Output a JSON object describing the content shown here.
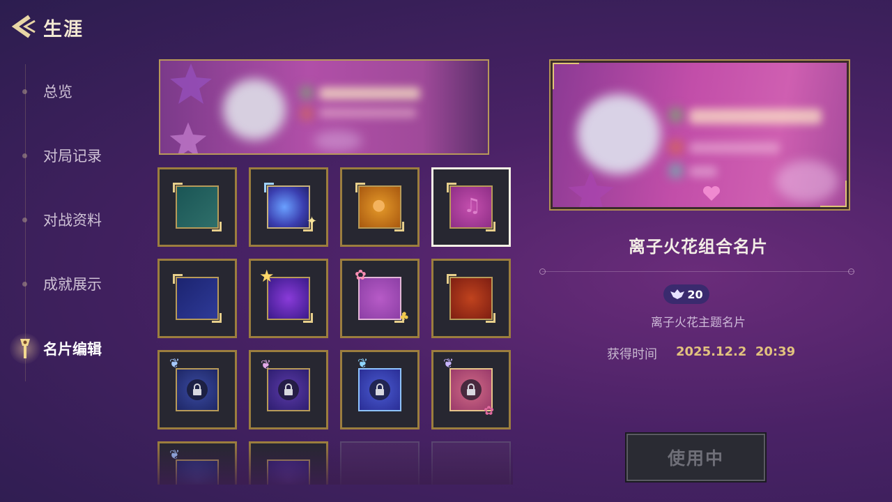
{
  "header": {
    "title": "生涯",
    "back_icon": "back-arrow-icon"
  },
  "sidebar": {
    "items": [
      {
        "label": "总览",
        "active": false
      },
      {
        "label": "对局记录",
        "active": false
      },
      {
        "label": "对战资料",
        "active": false
      },
      {
        "label": "成就展示",
        "active": false
      },
      {
        "label": "名片编辑",
        "active": true,
        "icon": "torch-icon"
      }
    ]
  },
  "grid": {
    "tiles": [
      {
        "theme": "teal",
        "locked": false,
        "selected": false
      },
      {
        "theme": "galaxy-blue",
        "locked": false,
        "selected": false
      },
      {
        "theme": "orange-paw",
        "locked": false,
        "selected": false
      },
      {
        "theme": "pink-music",
        "locked": false,
        "selected": true
      },
      {
        "theme": "navy",
        "locked": false,
        "selected": false
      },
      {
        "theme": "purple-star",
        "locked": false,
        "selected": false
      },
      {
        "theme": "pink-bell",
        "locked": false,
        "selected": false
      },
      {
        "theme": "red-crown",
        "locked": false,
        "selected": false
      },
      {
        "theme": "blue-ornate",
        "locked": true,
        "selected": false
      },
      {
        "theme": "violet-ornate",
        "locked": true,
        "selected": false
      },
      {
        "theme": "cyan-ornate",
        "locked": true,
        "selected": false
      },
      {
        "theme": "rose-ornate",
        "locked": true,
        "selected": false
      },
      {
        "theme": "blue-ornate-2",
        "locked": true,
        "selected": false
      },
      {
        "theme": "violet-ornate-2",
        "locked": true,
        "selected": false
      },
      {
        "theme": "empty",
        "locked": false,
        "selected": false
      },
      {
        "theme": "empty",
        "locked": false,
        "selected": false
      }
    ]
  },
  "detail": {
    "title": "离子火花组合名片",
    "price": "20",
    "price_icon": "gem-currency-icon",
    "subtitle": "离子火花主题名片",
    "acquired_label": "获得时间",
    "acquired_value": "2025.12.2  20:39",
    "use_button_label": "使用中"
  },
  "colors": {
    "gold": "#b8985a",
    "gold_text": "#e2c27e",
    "accent_pink": "#c24ea9"
  }
}
